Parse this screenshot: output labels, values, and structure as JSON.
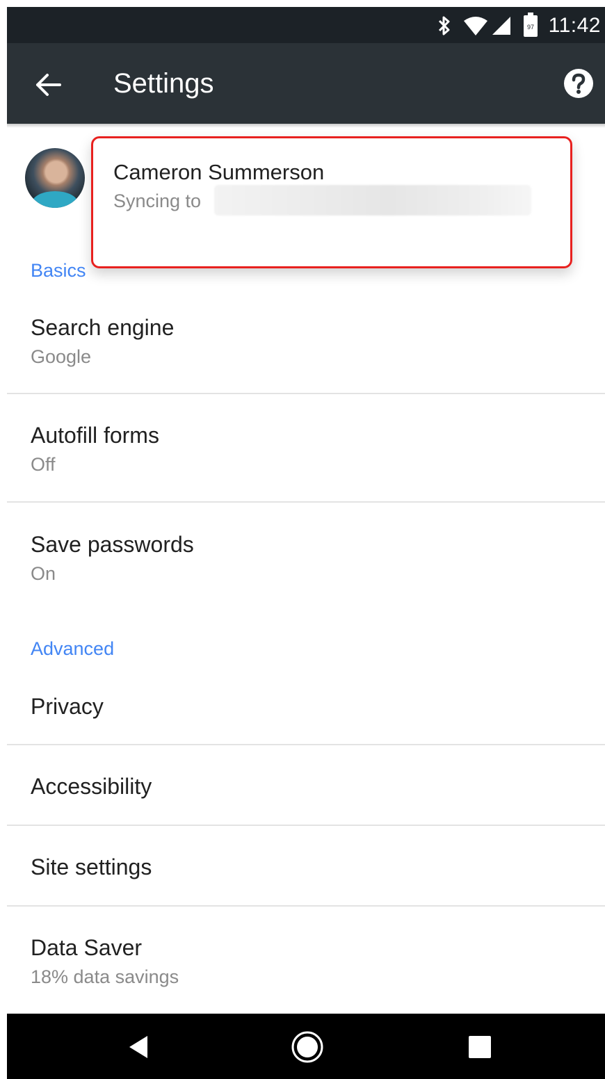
{
  "status_bar": {
    "time": "11:42",
    "battery_level": "97"
  },
  "app_bar": {
    "title": "Settings"
  },
  "account": {
    "name": "Cameron Summerson",
    "sync_text": "Syncing to"
  },
  "sections": {
    "basics": "Basics",
    "advanced": "Advanced"
  },
  "settings": {
    "search_engine": {
      "title": "Search engine",
      "value": "Google"
    },
    "autofill": {
      "title": "Autofill forms",
      "value": "Off"
    },
    "passwords": {
      "title": "Save passwords",
      "value": "On"
    },
    "privacy": {
      "title": "Privacy"
    },
    "accessibility": {
      "title": "Accessibility"
    },
    "site_settings": {
      "title": "Site settings"
    },
    "data_saver": {
      "title": "Data Saver",
      "value": "18% data savings"
    }
  },
  "colors": {
    "accent": "#4285f4",
    "highlight": "#e8211f",
    "toolbar": "#2b3237",
    "status_bar": "#1c2227"
  },
  "icons": [
    "bluetooth-icon",
    "wifi-icon",
    "signal-icon",
    "battery-icon",
    "back-arrow-icon",
    "help-icon",
    "nav-back-icon",
    "nav-home-icon",
    "nav-recents-icon"
  ]
}
